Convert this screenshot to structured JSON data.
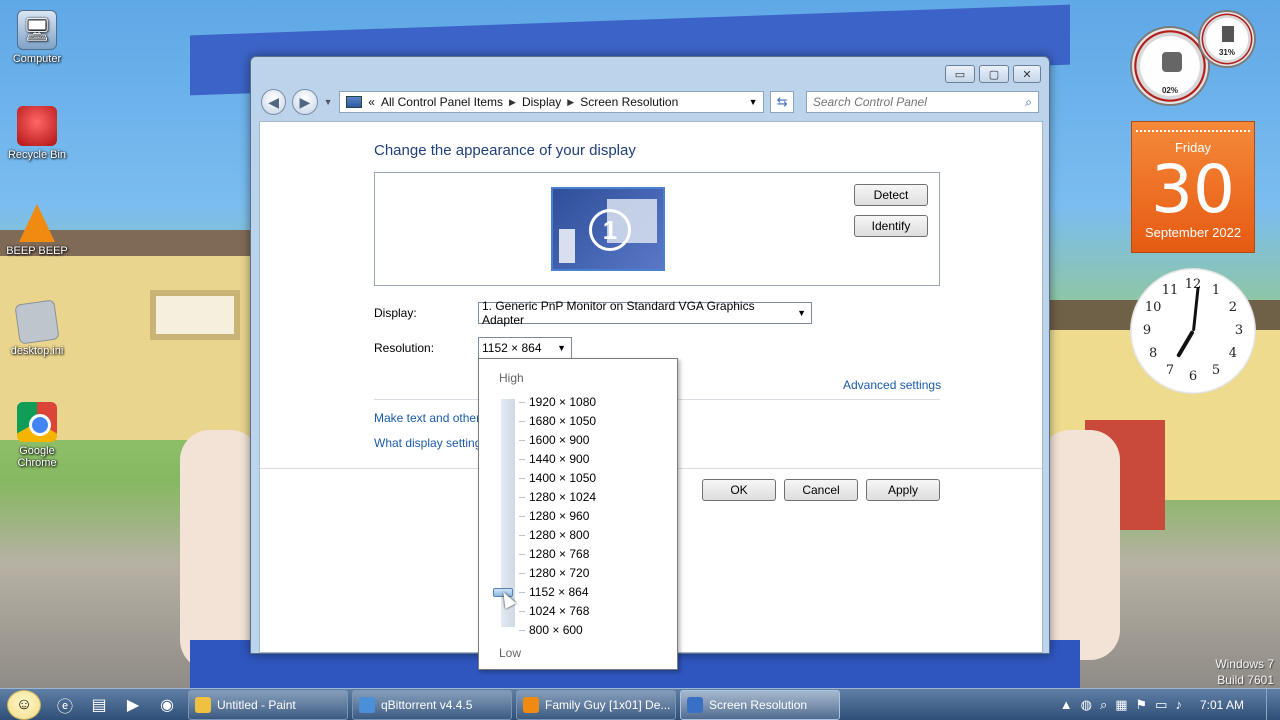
{
  "desktop": {
    "icons": [
      {
        "label": "Computer"
      },
      {
        "label": "Recycle Bin"
      },
      {
        "label": "BEEP BEEP"
      },
      {
        "label": "desktop.ini"
      },
      {
        "label": "Google Chrome"
      }
    ],
    "watermark": {
      "line1": "Windows 7",
      "line2": "Build 7601"
    }
  },
  "gadgets": {
    "cpu_meter": {
      "cpu": "02%",
      "memory": "31%"
    },
    "calendar": {
      "day": "Friday",
      "date": "30",
      "month_year": "September 2022"
    },
    "clock": {
      "numbers": [
        "12",
        "1",
        "2",
        "3",
        "4",
        "5",
        "6",
        "7",
        "8",
        "9",
        "10",
        "11"
      ],
      "hour": 7,
      "minute": 1
    }
  },
  "window": {
    "title_buttons": {
      "minimize": "▭",
      "maximize": "▢",
      "close": "✕"
    },
    "address": {
      "prefix": "«",
      "breadcrumbs": [
        "All Control Panel Items",
        "Display",
        "Screen Resolution"
      ]
    },
    "search": {
      "placeholder": "Search Control Panel"
    },
    "heading": "Change the appearance of your display",
    "monitor_number": "1",
    "buttons": {
      "detect": "Detect",
      "identify": "Identify",
      "ok": "OK",
      "cancel": "Cancel",
      "apply": "Apply"
    },
    "display_label": "Display:",
    "display_value": "1. Generic PnP Monitor on Standard VGA Graphics Adapter",
    "resolution_label": "Resolution:",
    "resolution_value": "1152 × 864",
    "advanced_settings": "Advanced settings",
    "links": {
      "make_text": "Make text and other",
      "what_display": "What display setting"
    }
  },
  "resolution_popup": {
    "high_label": "High",
    "low_label": "Low",
    "options": [
      "1920 × 1080",
      "1680 × 1050",
      "1600 × 900",
      "1440 × 900",
      "1400 × 1050",
      "1280 × 1024",
      "1280 × 960",
      "1280 × 800",
      "1280 × 768",
      "1280 × 720",
      "1152 × 864",
      "1024 × 768",
      "800 × 600"
    ],
    "selected_index": 10
  },
  "taskbar": {
    "tasks": [
      {
        "label": "Untitled - Paint",
        "active": false
      },
      {
        "label": "qBittorrent v4.4.5",
        "active": false
      },
      {
        "label": "Family Guy [1x01] De...",
        "active": false
      },
      {
        "label": "Screen Resolution",
        "active": true
      }
    ],
    "time": "7:01 AM"
  },
  "colors": {
    "accent_link": "#1a5aa8",
    "heading": "#1f3f7a",
    "calendar": "#e65a12"
  }
}
